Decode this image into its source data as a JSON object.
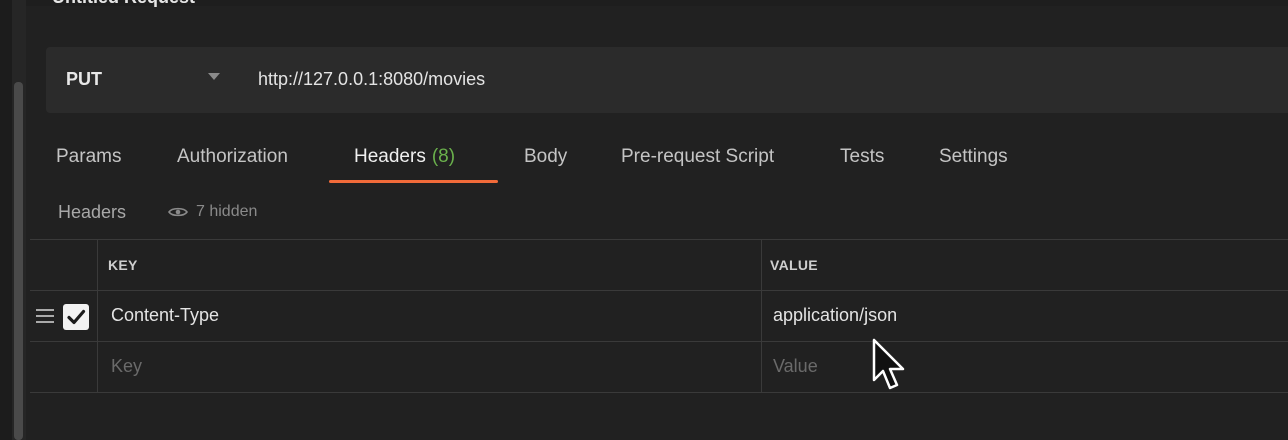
{
  "window": {
    "title": "Untitled Request"
  },
  "request": {
    "method": "PUT",
    "url": "http://127.0.0.1:8080/movies"
  },
  "tabs": [
    {
      "label": "Params"
    },
    {
      "label": "Authorization"
    },
    {
      "label": "Headers",
      "count": "(8)",
      "active": true
    },
    {
      "label": "Body"
    },
    {
      "label": "Pre-request Script"
    },
    {
      "label": "Tests"
    },
    {
      "label": "Settings"
    }
  ],
  "headers_section": {
    "title": "Headers",
    "hidden_label": "7 hidden",
    "hidden_icon": "eye-icon"
  },
  "table": {
    "columns": [
      "KEY",
      "VALUE"
    ],
    "rows": [
      {
        "key": "Content-Type",
        "value": "application/json",
        "checked": true
      }
    ],
    "placeholder": {
      "key": "Key",
      "value": "Value"
    }
  },
  "colors": {
    "accent": "#f26b3a",
    "count": "#6ab04c",
    "background": "#212121"
  }
}
